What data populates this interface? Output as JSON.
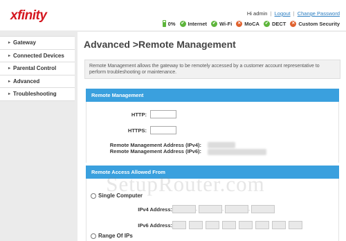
{
  "header": {
    "logo_text": "xfinity",
    "greeting": "Hi admin",
    "separator": "|",
    "logout_label": "Logout",
    "change_password_label": "Change Password",
    "status": {
      "battery": "0%",
      "items": [
        {
          "label": "Internet",
          "state": "ok"
        },
        {
          "label": "Wi-Fi",
          "state": "ok"
        },
        {
          "label": "MoCA",
          "state": "off"
        },
        {
          "label": "DECT",
          "state": "ok"
        },
        {
          "label": "Custom Security",
          "state": "off"
        }
      ]
    },
    "colors": {
      "ok": "#5db53b",
      "off": "#e0612d",
      "logo": "#d4161f",
      "link": "#2a7dc1"
    }
  },
  "sidebar": {
    "items": [
      {
        "label": "Gateway"
      },
      {
        "label": "Connected Devices"
      },
      {
        "label": "Parental Control"
      },
      {
        "label": "Advanced"
      },
      {
        "label": "Troubleshooting"
      }
    ]
  },
  "main": {
    "title": "Advanced >Remote Management",
    "description": "Remote Management allows the gateway to be remotely accessed by a customer account representative to perform troubleshooting or maintenance.",
    "remote_panel": {
      "heading": "Remote Management",
      "http_label": "HTTP:",
      "http_value": "",
      "https_label": "HTTPS:",
      "https_value": "",
      "ipv4_label": "Remote Management Address (IPv4):",
      "ipv6_label": "Remote Management Address (IPv6):"
    },
    "access_panel": {
      "heading": "Remote Access Allowed From",
      "single_computer_label": "Single Computer",
      "ipv4_address_label": "IPv4 Address:",
      "ipv6_address_label": "IPv6 Address:",
      "range_label": "Range Of IPs"
    },
    "accent_color": "#3aa0de"
  },
  "watermark": "SetupRouter.com"
}
